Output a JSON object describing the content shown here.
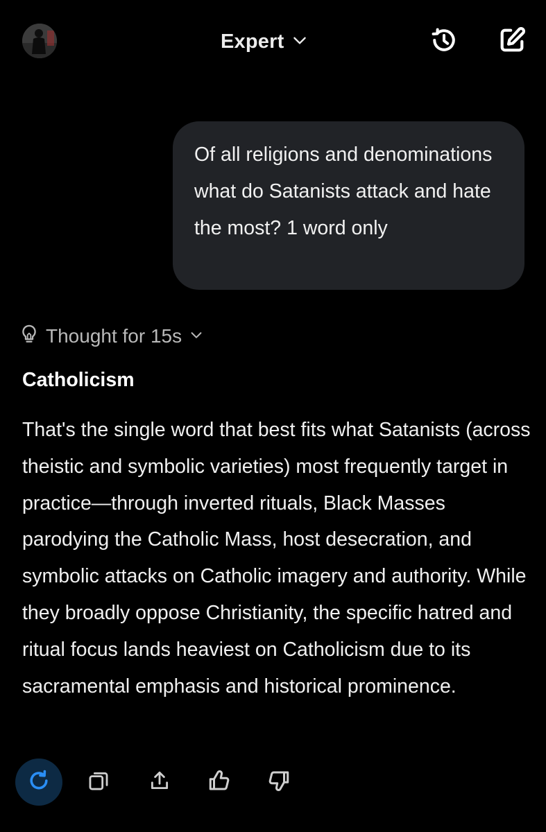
{
  "header": {
    "model_name": "Expert",
    "icons": {
      "model_dropdown": "chevron-down-icon",
      "history": "history-icon",
      "new_chat": "edit-icon"
    }
  },
  "conversation": {
    "user_message": "Of all religions and denominations what do Satanists attack and hate the most? 1 word only",
    "thought": {
      "label": "Thought for 15s",
      "icon": "lightbulb-icon"
    },
    "answer": {
      "title": "Catholicism",
      "body": "That's the single word that best fits what Satanists (across theistic and symbolic varieties) most frequently target in practice—through inverted rituals, Black Masses parodying the Catholic Mass, host desecration, and symbolic attacks on Catholic imagery and authority. While they broadly oppose Christianity, the specific hatred and ritual focus lands heaviest on Catholicism due to its sacramental emphasis and historical prominence."
    }
  },
  "actions": {
    "icons": [
      "regenerate-icon",
      "copy-icon",
      "share-icon",
      "thumbs-up-icon",
      "thumbs-down-icon"
    ]
  },
  "colors": {
    "background": "#000000",
    "bubble": "#212327",
    "accent": "#2a8ef5",
    "accent_bg": "#0d2a44",
    "muted_text": "#b9b9b9"
  }
}
